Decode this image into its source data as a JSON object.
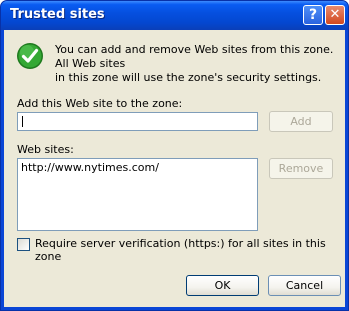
{
  "window": {
    "title": "Trusted sites"
  },
  "titlebar": {
    "help_glyph": "?",
    "close_glyph": "✕"
  },
  "info": {
    "icon": "checkmark-icon",
    "text": "You can add and remove Web sites from this zone. All Web sites\nin this zone will use the zone's security settings."
  },
  "add_site": {
    "label": "Add this Web site to the zone:",
    "value": "",
    "add_button": "Add"
  },
  "websites": {
    "label": "Web sites:",
    "items": [
      "http://www.nytimes.com/"
    ],
    "remove_button": "Remove"
  },
  "verification": {
    "label": "Require server verification (https:) for all sites in this zone",
    "checked": false
  },
  "footer": {
    "ok_button": "OK",
    "cancel_button": "Cancel"
  },
  "colors": {
    "titlebar": "#0a5cf2",
    "dialog_bg": "#ece9d8",
    "icon_green": "#2e9e2e"
  }
}
